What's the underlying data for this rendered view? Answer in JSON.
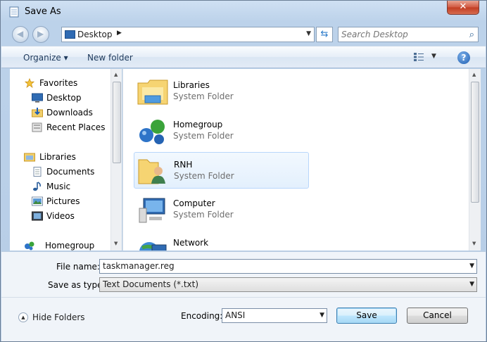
{
  "window": {
    "title": "Save As",
    "close_label": "✕"
  },
  "nav": {
    "address": "Desktop",
    "search_placeholder": "Search Desktop"
  },
  "toolbar": {
    "organize": "Organize ▾",
    "new_folder": "New folder",
    "help": "?"
  },
  "sidebar": {
    "items": [
      {
        "label": "Favorites",
        "icon": "star-icon"
      },
      {
        "label": "Desktop",
        "icon": "desktop-icon"
      },
      {
        "label": "Downloads",
        "icon": "downloads-icon"
      },
      {
        "label": "Recent Places",
        "icon": "recent-places-icon"
      },
      {
        "label": "Libraries",
        "icon": "libraries-icon"
      },
      {
        "label": "Documents",
        "icon": "documents-icon"
      },
      {
        "label": "Music",
        "icon": "music-icon"
      },
      {
        "label": "Pictures",
        "icon": "pictures-icon"
      },
      {
        "label": "Videos",
        "icon": "videos-icon"
      },
      {
        "label": "Homegroup",
        "icon": "homegroup-icon"
      }
    ]
  },
  "content": {
    "items": [
      {
        "name": "Libraries",
        "type": "System Folder",
        "icon": "library-folder-icon"
      },
      {
        "name": "Homegroup",
        "type": "System Folder",
        "icon": "homegroup-icon"
      },
      {
        "name": "RNH",
        "type": "System Folder",
        "icon": "user-folder-icon"
      },
      {
        "name": "Computer",
        "type": "System Folder",
        "icon": "computer-icon"
      },
      {
        "name": "Network",
        "type": "",
        "icon": "network-icon"
      }
    ]
  },
  "form": {
    "file_name_label": "File name:",
    "file_name_value": "taskmanager.reg",
    "save_type_label": "Save as type:",
    "save_type_value": "Text Documents (*.txt)",
    "encoding_label": "Encoding:",
    "encoding_value": "ANSI",
    "hide_folders": "Hide Folders",
    "save": "Save",
    "cancel": "Cancel"
  },
  "colors": {
    "accent": "#3c7fb1",
    "selection": "#e3f0fd",
    "frame": "#b9d1ea"
  }
}
